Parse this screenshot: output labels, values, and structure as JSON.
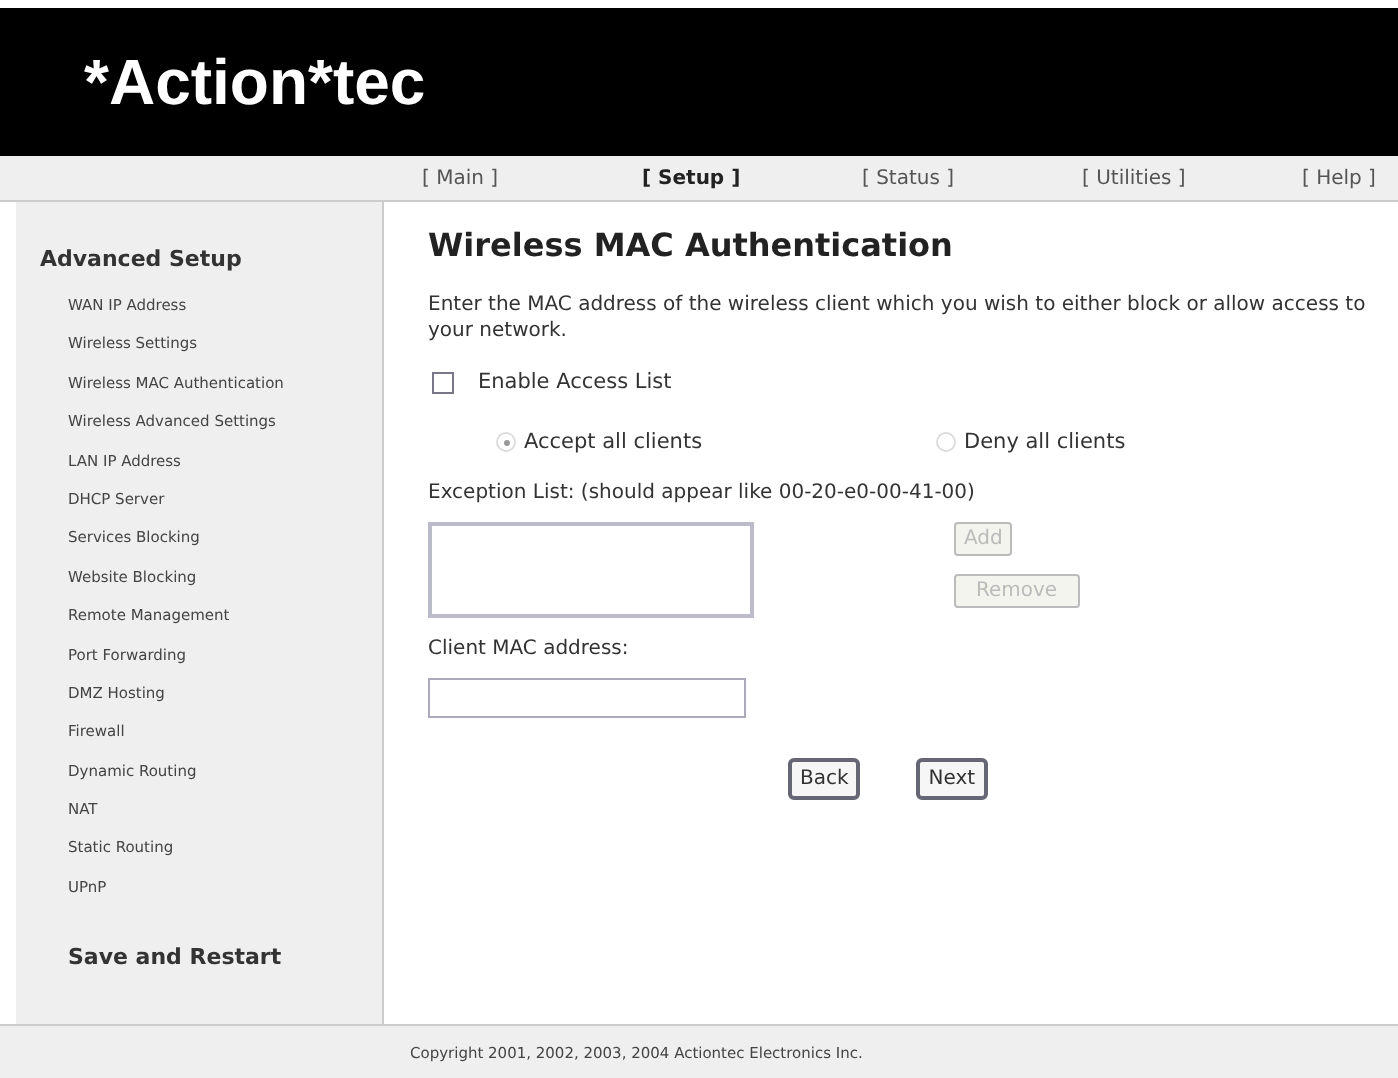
{
  "logo": "*Action*tec",
  "nav": [
    {
      "label": "[ Main ]",
      "selected": false
    },
    {
      "label": "[ Setup ]",
      "selected": true
    },
    {
      "label": "[ Status ]",
      "selected": false
    },
    {
      "label": "[ Utilities ]",
      "selected": false
    },
    {
      "label": "[ Help ]",
      "selected": false
    }
  ],
  "sidebar": {
    "title": "Advanced Setup",
    "items": [
      "WAN IP Address",
      "Wireless Settings",
      "Wireless MAC Authentication",
      "Wireless Advanced Settings",
      "LAN IP Address",
      "DHCP Server",
      "Services Blocking",
      "Website Blocking",
      "Remote Management",
      "Port Forwarding",
      "DMZ Hosting",
      "Firewall",
      "Dynamic Routing",
      "NAT",
      "Static Routing",
      "UPnP"
    ],
    "footer_link": "Save and Restart"
  },
  "main": {
    "title": "Wireless MAC Authentication",
    "description": "Enter the MAC address of the wireless client which you wish to either block or allow access to your network.",
    "enable_access_list": {
      "label": "Enable Access List",
      "checked": false
    },
    "radios": [
      {
        "label": "Accept all clients",
        "selected": true
      },
      {
        "label": "Deny all clients",
        "selected": false
      }
    ],
    "exception_label": "Exception List: (should appear like 00-20-e0-00-41-00)",
    "list_buttons": [
      {
        "label": "Add",
        "disabled": true
      },
      {
        "label": "Remove",
        "disabled": true
      }
    ],
    "client_mac_label": "Client MAC address:",
    "buttons": [
      "Back",
      "Next"
    ]
  },
  "footer": "Copyright 2001, 2002, 2003, 2004 Actiontec Electronics Inc."
}
